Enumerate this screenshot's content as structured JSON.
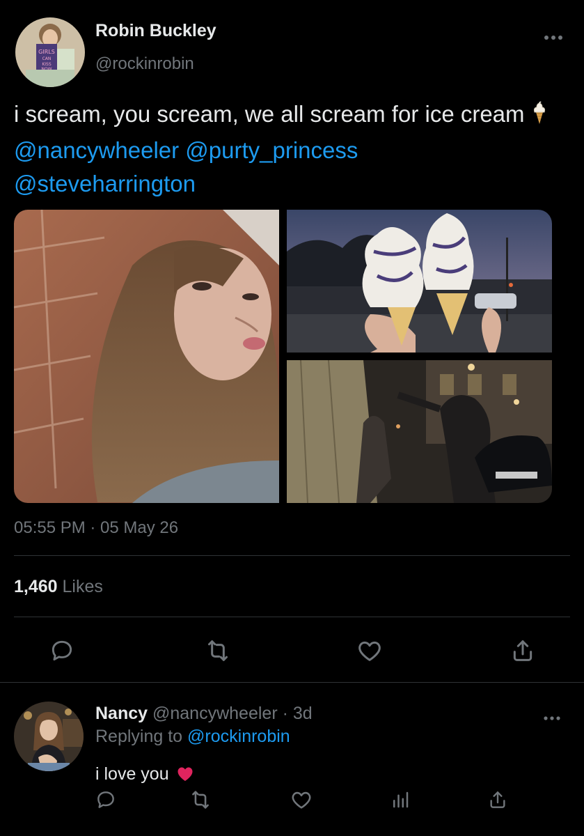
{
  "tweet": {
    "author_name": "Robin Buckley",
    "author_handle": "@rockinrobin",
    "more_icon": "more-horizontal-icon",
    "text_part1": "i scream, you scream, we all scream for ice cream",
    "emoji": "soft-ice-cream",
    "mentions": [
      "@nancywheeler",
      "@purty_princess",
      "@steveharrington"
    ],
    "media_count": 3,
    "timestamp": "05:55 PM · 05 May 26",
    "likes_count": "1,460",
    "likes_label": "Likes",
    "actions": [
      "reply-icon",
      "retweet-icon",
      "like-icon",
      "share-icon"
    ]
  },
  "reply": {
    "name": "Nancy",
    "handle": "@nancywheeler",
    "age": "· 3d",
    "replying_prefix": "Replying to",
    "replying_to": "@rockinrobin",
    "text": "i love you",
    "emoji": "red-heart",
    "actions": [
      "reply-icon",
      "retweet-icon",
      "like-icon",
      "analytics-icon",
      "share-icon"
    ]
  },
  "colors": {
    "background": "#000000",
    "text": "#e7e9ea",
    "secondary": "#71767b",
    "accent": "#1d9bf0",
    "divider": "#2f3336",
    "heart": "#e0245e"
  }
}
